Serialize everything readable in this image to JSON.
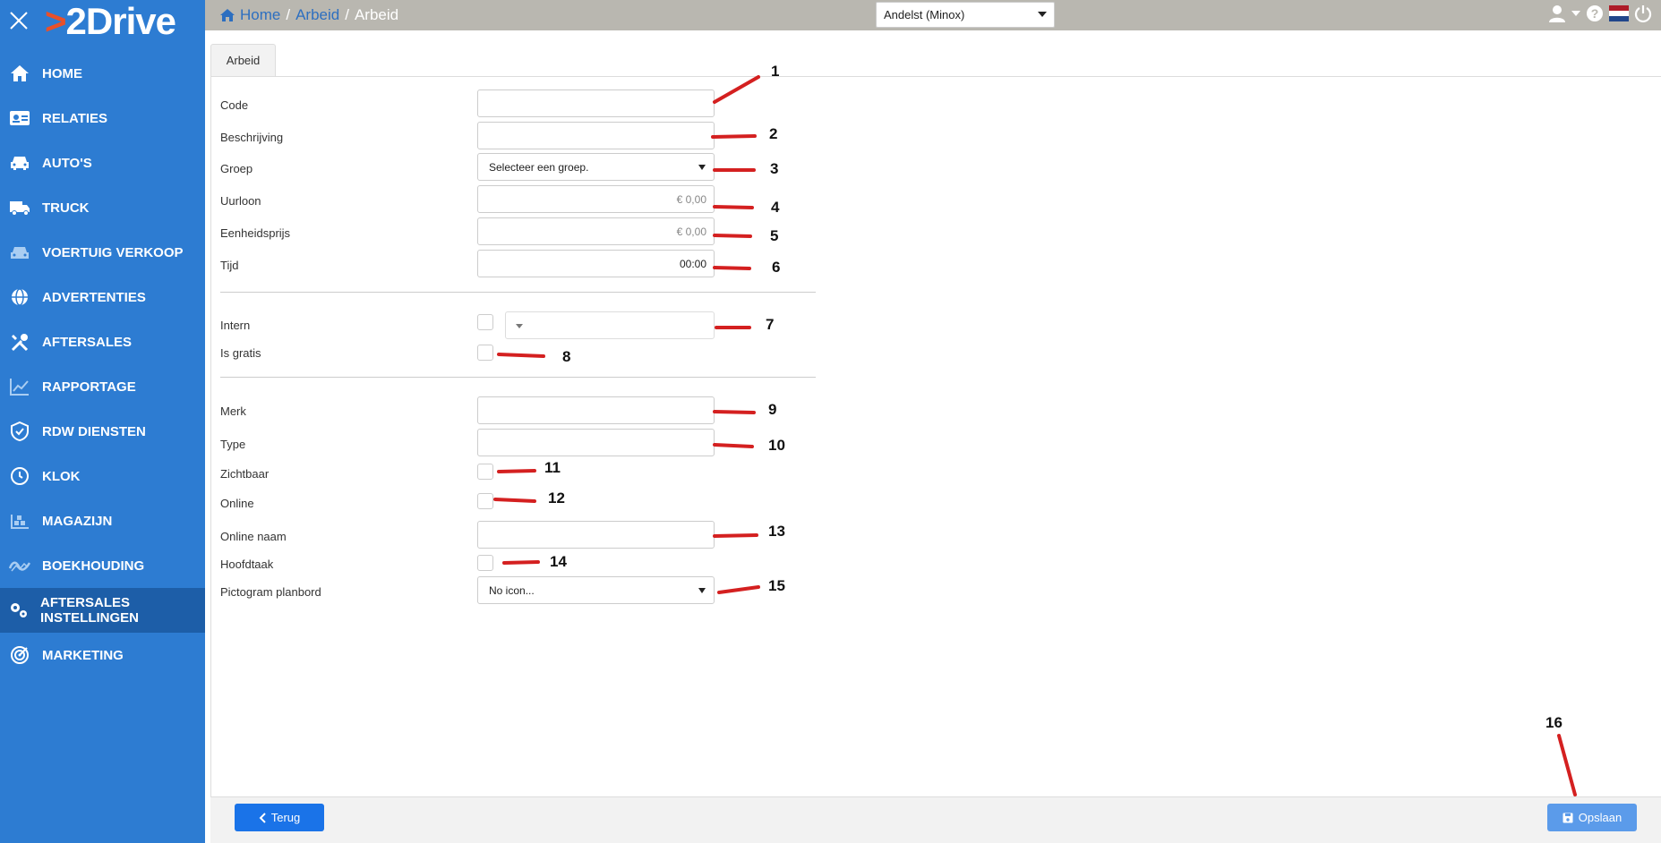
{
  "app": {
    "logo_prefix": ">",
    "logo_text": "2Drive"
  },
  "sidebar": {
    "items": [
      {
        "label": "HOME",
        "icon": "home-icon"
      },
      {
        "label": "RELATIES",
        "icon": "id-card-icon"
      },
      {
        "label": "AUTO'S",
        "icon": "car-icon"
      },
      {
        "label": "TRUCK",
        "icon": "truck-icon"
      },
      {
        "label": "VOERTUIG VERKOOP",
        "icon": "car-sale-icon"
      },
      {
        "label": "ADVERTENTIES",
        "icon": "globe-icon"
      },
      {
        "label": "AFTERSALES",
        "icon": "tools-icon"
      },
      {
        "label": "RAPPORTAGE",
        "icon": "chart-icon"
      },
      {
        "label": "RDW DIENSTEN",
        "icon": "shield-icon"
      },
      {
        "label": "KLOK",
        "icon": "clock-icon"
      },
      {
        "label": "MAGAZIJN",
        "icon": "warehouse-icon"
      },
      {
        "label": "BOEKHOUDING",
        "icon": "ledger-icon"
      },
      {
        "label": "AFTERSALES INSTELLINGEN",
        "icon": "gears-icon",
        "active": true
      },
      {
        "label": "MARKETING",
        "icon": "target-icon"
      }
    ]
  },
  "topbar": {
    "breadcrumb": [
      "Home",
      "Arbeid",
      "Arbeid"
    ],
    "branch": "Andelst (Minox)"
  },
  "tab": {
    "label": "Arbeid"
  },
  "form": {
    "code_label": "Code",
    "beschrijving_label": "Beschrijving",
    "groep_label": "Groep",
    "groep_value": "Selecteer een groep.",
    "uurloon_label": "Uurloon",
    "uurloon_value": "€ 0,00",
    "eenheidsprijs_label": "Eenheidsprijs",
    "eenheidsprijs_value": "€ 0,00",
    "tijd_label": "Tijd",
    "tijd_value": "00:00",
    "intern_label": "Intern",
    "is_gratis_label": "Is gratis",
    "merk_label": "Merk",
    "type_label": "Type",
    "zichtbaar_label": "Zichtbaar",
    "online_label": "Online",
    "online_naam_label": "Online naam",
    "hoofdtaak_label": "Hoofdtaak",
    "pictogram_label": "Pictogram planbord",
    "pictogram_value": "No icon..."
  },
  "annotations": [
    "1",
    "2",
    "3",
    "4",
    "5",
    "6",
    "7",
    "8",
    "9",
    "10",
    "11",
    "12",
    "13",
    "14",
    "15",
    "16"
  ],
  "footer": {
    "back_label": "Terug",
    "save_label": "Opslaan"
  },
  "colors": {
    "sidebar": "#2d7cd2",
    "sidebar_active": "#1d5ea8",
    "topbar": "#b9b7b0",
    "annotation_line": "#d42020",
    "primary_button": "#1a73e8"
  }
}
